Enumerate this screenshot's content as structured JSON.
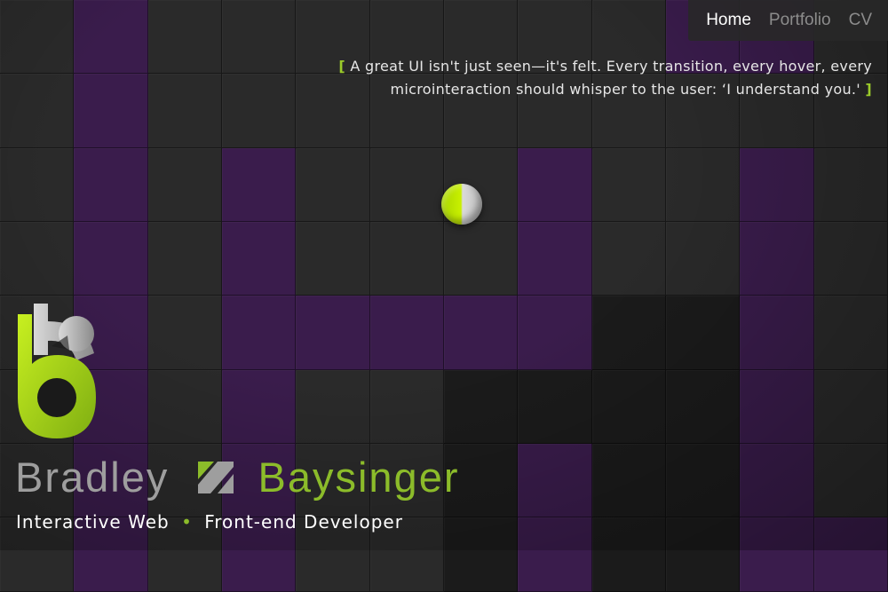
{
  "nav": {
    "items": [
      {
        "label": "Home",
        "active": true
      },
      {
        "label": "Portfolio",
        "active": false
      },
      {
        "label": "CV",
        "active": false
      }
    ]
  },
  "quote": {
    "open_bracket": "[",
    "text": "A great UI isn't just seen—it's felt. Every transition, every hover, every microinteraction should whisper to the user: ‘I understand you.'",
    "close_bracket": "]"
  },
  "brand": {
    "first_name": "Bradley",
    "last_name": "Baysinger",
    "tagline_part1": "Interactive Web",
    "tagline_separator": "•",
    "tagline_part2": "Front-end Developer"
  },
  "colors": {
    "accent_green": "#8cbc2a",
    "purple_tile": "#3a1c4c",
    "dark_tile": "#2a2a2a",
    "background": "#1a1a1a"
  },
  "icons": {
    "logo": "bb-monogram-icon",
    "slash": "slash-divider-icon",
    "ball": "green-white-sphere"
  }
}
